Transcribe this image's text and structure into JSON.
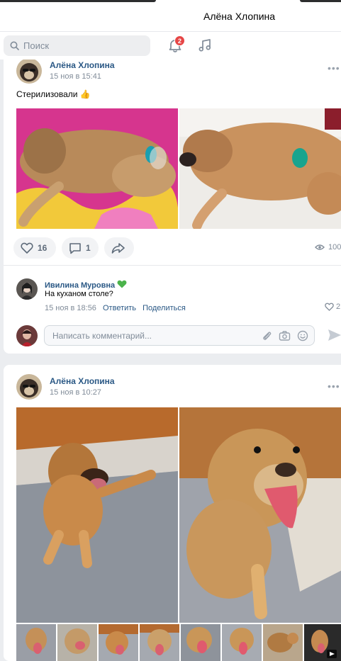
{
  "profile": {
    "name": "Алёна Хлопина"
  },
  "header": {
    "search_placeholder": "Поиск",
    "notifications_count": "2"
  },
  "post1": {
    "author": "Алёна Хлопина",
    "date": "15 ноя в 15:41",
    "text": "Стерилизовали",
    "emoji": "👍",
    "likes": "16",
    "comments": "1",
    "views": "100"
  },
  "comment": {
    "author": "Ивилина Муровна",
    "text": "На куханом столе?",
    "date": "15 ноя в 18:56",
    "reply_label": "Ответить",
    "share_label": "Поделиться",
    "likes": "2",
    "input_placeholder": "Написать комментарий..."
  },
  "post2": {
    "author": "Алёна Хлопина",
    "date": "15 ноя в 10:27"
  },
  "colors": {
    "link": "#2a5885",
    "badge": "#e64646",
    "muted": "#818c99"
  }
}
